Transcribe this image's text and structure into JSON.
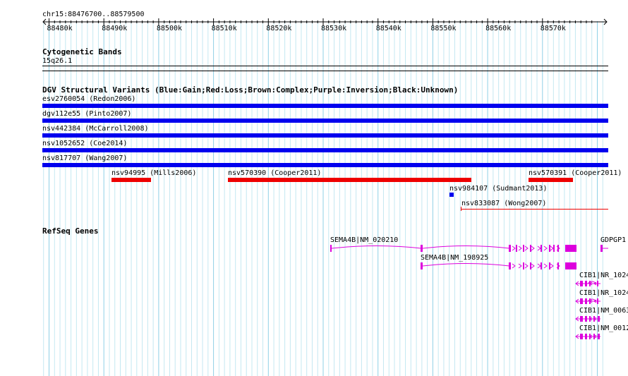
{
  "ruler": {
    "position": "chr15:88476700..88579500",
    "ticks": [
      "88480k",
      "88490k",
      "88500k",
      "88510k",
      "88520k",
      "88530k",
      "88540k",
      "88550k",
      "88560k",
      "88570k"
    ]
  },
  "cytoband": {
    "title": "Cytogenetic Bands",
    "band": "15q26.1"
  },
  "dgv": {
    "title": "DGV Structural Variants (Blue:Gain;Red:Loss;Brown:Complex;Purple:Inversion;Black:Unknown)",
    "full_span": [
      {
        "label": "esv2760054 (Redon2006)",
        "color": "#0000ee"
      },
      {
        "label": "dgv112e55 (Pinto2007)",
        "color": "#0000ee"
      },
      {
        "label": "nsv442384 (McCarroll2008)",
        "color": "#0000ee"
      },
      {
        "label": "nsv1052652 (Coe2014)",
        "color": "#0000ee"
      },
      {
        "label": "nsv817707 (Wang2007)",
        "color": "#0000ee"
      }
    ],
    "partial": [
      {
        "label": "nsv94995 (Mills2006)",
        "color": "#ee0000"
      },
      {
        "label": "nsv570390 (Cooper2011)",
        "color": "#ee0000"
      },
      {
        "label": "nsv570391 (Cooper2011)",
        "color": "#ee0000"
      },
      {
        "label": "nsv984107 (Sudmant2013)",
        "color": "#0000ee"
      },
      {
        "label": "nsv833087 (Wong2007)",
        "color": "#ee0000"
      }
    ]
  },
  "refseq": {
    "title": "RefSeq Genes",
    "color": "#dd00dd",
    "genes": [
      {
        "label": "SEMA4B|NM_020210"
      },
      {
        "label": "SEMA4B|NM_198925"
      },
      {
        "label": "GDPGP1"
      },
      {
        "label": "CIB1|NR_1024"
      },
      {
        "label": "CIB1|NR_1024"
      },
      {
        "label": "CIB1|NM_0063"
      },
      {
        "label": "CIB1|NM_0012"
      }
    ]
  }
}
